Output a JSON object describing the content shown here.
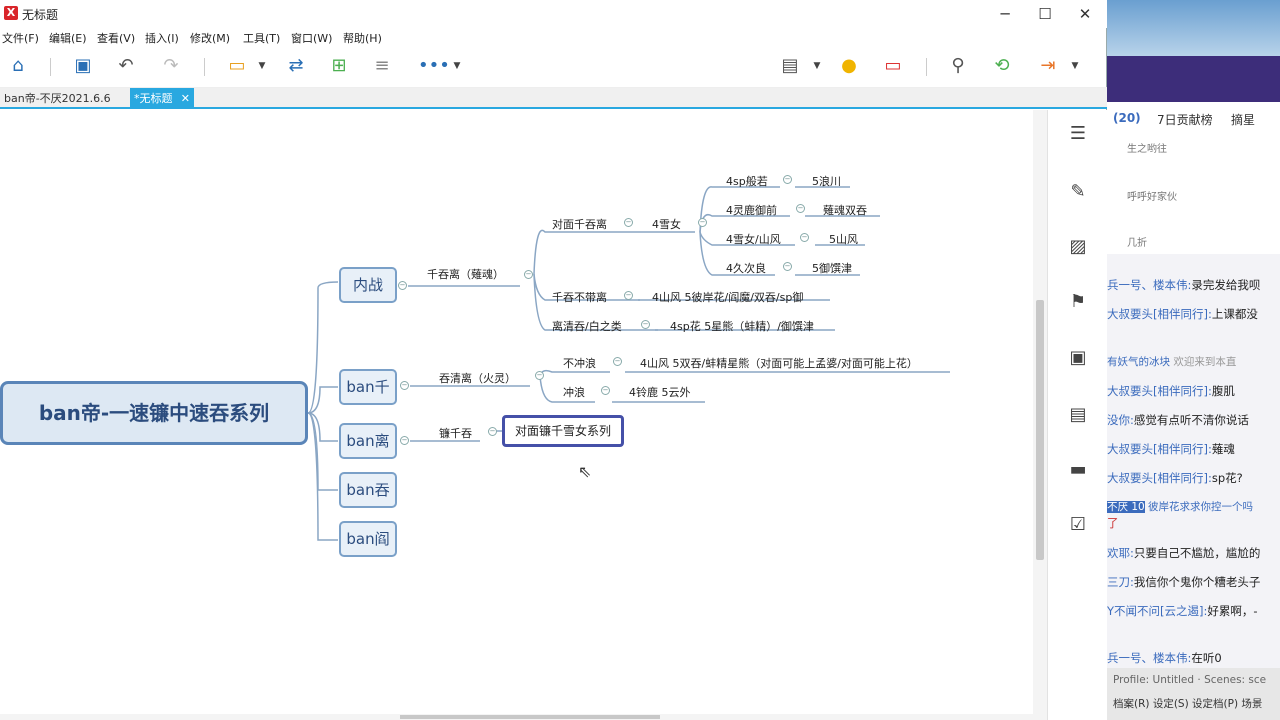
{
  "window": {
    "title": "无标题",
    "logo": "X"
  },
  "menu": [
    "文件(F)",
    "编辑(E)",
    "查看(V)",
    "插入(I)",
    "修改(M)",
    "工具(T)",
    "窗口(W)",
    "帮助(H)"
  ],
  "tabs": [
    {
      "label": "ban帝-不厌2021.6.6"
    },
    {
      "label": "*无标题",
      "close": "✕"
    }
  ],
  "toolbar": {
    "more": "•••"
  },
  "mindmap": {
    "root": "ban帝-一速镰中速吞系列",
    "l1": [
      "内战",
      "ban千",
      "ban离",
      "ban吞",
      "ban阎"
    ],
    "neizhan": {
      "branch": "千吞离（薙魂）",
      "n1": "对面千吞离",
      "n1a": "4雪女",
      "n1a_children": [
        {
          "a": "4sp般若",
          "b": "5浪川"
        },
        {
          "a": "4灵鹿御前",
          "b": "薙魂双吞"
        },
        {
          "a": "4雪女/山风",
          "b": "5山风"
        },
        {
          "a": "4久次良",
          "b": "5御馔津"
        }
      ],
      "n2": "千吞不带离",
      "n2a": "4山风 5彼岸花/阎魔/双吞/sp御",
      "n3": "离清吞/白之类",
      "n3a": "4sp花 5星熊（蚌精）/御馔津"
    },
    "banqian": {
      "branch": "吞清离（火灵）",
      "n1": "不冲浪",
      "n1a": "4山风 5双吞/蚌精星熊（对面可能上孟婆/对面可能上花）",
      "n2": "冲浪",
      "n2a": "4铃鹿 5云外"
    },
    "banli": {
      "branch": "镰千吞",
      "selected": "对面镰千雪女系列"
    }
  },
  "stream": {
    "tab_count": "(20)",
    "tab2": "7日贡献榜",
    "tab3": "摘星",
    "users": [
      "生之哟往",
      "呼呼好家伙",
      "几折"
    ],
    "messages": [
      {
        "user": "兵一号、楼本伟:",
        "text": "录完发给我呗"
      },
      {
        "user": "大叔要头[相伴同行]:",
        "text": "上课都没"
      },
      {
        "user": "有妖气的冰块",
        "text": "欢迎来到本直"
      },
      {
        "user": "大叔要头[相伴同行]:",
        "text": "腹肌"
      },
      {
        "user": "没你:",
        "text": "感觉有点听不清你说话"
      },
      {
        "user": "大叔要头[相伴同行]:",
        "text": "薙魂"
      },
      {
        "user": "大叔要头[相伴同行]:",
        "text": "sp花?"
      },
      {
        "user": "不厌 10",
        "text": "彼岸花求求你控一个吗"
      },
      {
        "user": "",
        "text": "了"
      },
      {
        "user": "欢耶:",
        "text": "只要自己不尴尬，尴尬的"
      },
      {
        "user": "三刀:",
        "text": "我信你个鬼你个糟老头子"
      },
      {
        "user": "Y不闻不问[云之遏]:",
        "text": "好累啊，-"
      },
      {
        "user": "兵一号、楼本伟:",
        "text": "在听0"
      }
    ],
    "obs": {
      "profile": "Profile: Untitled · Scenes: sce",
      "menu": "档案(R)  设定(S)  设定档(P)  场景"
    }
  },
  "colors": {
    "accent": "#29a8e0",
    "root_border": "#5a85b8",
    "selected_border": "#4550a8"
  }
}
